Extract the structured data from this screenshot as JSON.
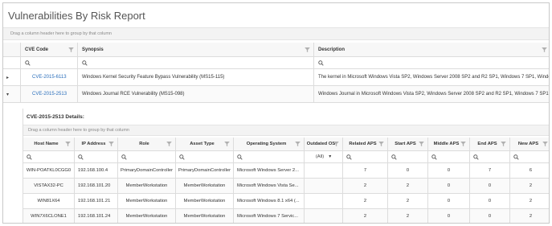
{
  "title": "Vulnerabilities By Risk Report",
  "group_hint": "Drag a column header here to group by that column",
  "main_columns": [
    {
      "label": "CVE Code"
    },
    {
      "label": "Synopsis"
    },
    {
      "label": "Description"
    }
  ],
  "main_rows": [
    {
      "expander": "▸",
      "cve": "CVE-2015-6113",
      "synopsis": "Windows Kernel Security Feature Bypass Vulnerability (MS15-115)",
      "description": "The kernel in Microsoft Windows Vista SP2, Windows Server 2008 SP2 and R2 SP1, Windows 7 SP1, Windo"
    },
    {
      "expander": "▾",
      "cve": "CVE-2015-2513",
      "synopsis": "Windows Journal RCE Vulnerability (MS15-098)",
      "description": "Windows Journal in Microsoft Windows Vista SP2, Windows Server 2008 SP2 and R2 SP1, Windows 7 SP1,"
    }
  ],
  "detail": {
    "title": "CVE-2015-2513 Details:",
    "group_hint": "Drag a column header here to group by that column",
    "columns": [
      {
        "label": "Host Name"
      },
      {
        "label": "IP Address"
      },
      {
        "label": "Role"
      },
      {
        "label": "Asset Type"
      },
      {
        "label": "Operating System"
      },
      {
        "label": "Outdated OS"
      },
      {
        "label": "Related APS"
      },
      {
        "label": "Start APS"
      },
      {
        "label": "Middle APS"
      },
      {
        "label": "End APS"
      },
      {
        "label": "New APS"
      }
    ],
    "outdated_filter": "(All)",
    "rows": [
      {
        "host": "WIN-POATKL0CGG0",
        "ip": "192.168.100.4",
        "role": "PrimaryDomainController",
        "asset": "PrimaryDomainController",
        "os": "Microsoft Windows Server 2...",
        "outdated": "",
        "related": "7",
        "start": "0",
        "middle": "0",
        "end": "7",
        "new": "6"
      },
      {
        "host": "VISTAX32-PC",
        "ip": "192.168.101.20",
        "role": "MemberWorkstation",
        "asset": "MemberWorkstation",
        "os": "Microsoft Windows Vista Se...",
        "outdated": "",
        "related": "2",
        "start": "2",
        "middle": "0",
        "end": "0",
        "new": "2"
      },
      {
        "host": "WIN81X64",
        "ip": "192.168.101.21",
        "role": "MemberWorkstation",
        "asset": "MemberWorkstation",
        "os": "Microsoft Windows 8.1 x64 (...",
        "outdated": "",
        "related": "2",
        "start": "2",
        "middle": "0",
        "end": "0",
        "new": "2"
      },
      {
        "host": "WIN7X6CLONE1",
        "ip": "192.168.101.24",
        "role": "MemberWorkstation",
        "asset": "MemberWorkstation",
        "os": "Microsoft Windows 7 Servic...",
        "outdated": "",
        "related": "2",
        "start": "2",
        "middle": "0",
        "end": "0",
        "new": "2"
      }
    ]
  },
  "colors": {
    "link": "#2a6ebb",
    "header_bg": "#f7f7f7",
    "border": "#dcdcdc"
  }
}
